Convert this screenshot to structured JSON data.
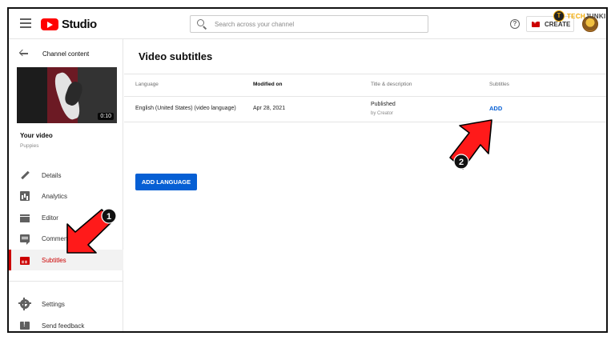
{
  "header": {
    "logo_text": "Studio",
    "search_placeholder": "Search across your channel",
    "help_glyph": "?",
    "create_label": "CREATE"
  },
  "watermark": {
    "prefix": "TECH",
    "suffix": "JUNKIE",
    "badge": "TJ"
  },
  "sidebar": {
    "back_label": "Channel content",
    "thumbnail_duration": "0:10",
    "your_video_label": "Your video",
    "video_name": "Puppies",
    "items": [
      {
        "label": "Details",
        "icon": "pencil-icon"
      },
      {
        "label": "Analytics",
        "icon": "analytics-icon"
      },
      {
        "label": "Editor",
        "icon": "editor-icon"
      },
      {
        "label": "Comments",
        "icon": "comments-icon"
      },
      {
        "label": "Subtitles",
        "icon": "subtitles-icon",
        "active": true
      }
    ],
    "bottom_items": [
      {
        "label": "Settings",
        "icon": "gear-icon"
      },
      {
        "label": "Send feedback",
        "icon": "feedback-icon"
      }
    ]
  },
  "main": {
    "title": "Video subtitles",
    "columns": [
      "Language",
      "Modified on",
      "Title & description",
      "Subtitles"
    ],
    "rows": [
      {
        "language": "English (United States) (video language)",
        "modified": "Apr 28, 2021",
        "status": "Published",
        "status_sub": "by Creator",
        "subtitles_action": "ADD"
      }
    ],
    "add_language_label": "ADD LANGUAGE"
  },
  "annotations": {
    "step1": "1",
    "step2": "2"
  },
  "colors": {
    "brand_red": "#ff0000",
    "active_red": "#cc0000",
    "link_blue": "#065fd4",
    "arrow_red": "#ff1a1a"
  }
}
